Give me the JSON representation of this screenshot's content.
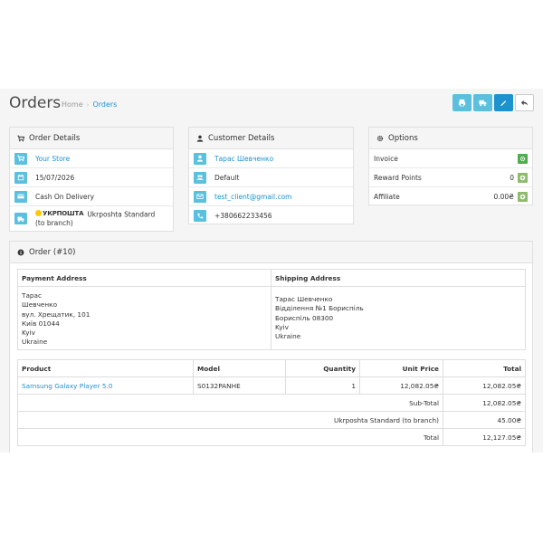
{
  "header": {
    "title": "Orders",
    "breadcrumb": [
      "Home",
      "Orders"
    ]
  },
  "colors": {
    "info": "#5bc0de",
    "primary": "#1e91cf",
    "success": "#8fbb6c",
    "success_dark": "#4cae4c"
  },
  "order_details": {
    "title": "Order Details",
    "store": "Your Store",
    "date": "15/07/2026",
    "payment": "Cash On Delivery",
    "shipping_logo": "УКРПОШТА",
    "shipping": "Ukrposhta Standard (to branch)"
  },
  "customer_details": {
    "title": "Customer Details",
    "name": "Тарас Шевченко",
    "group": "Default",
    "email": "test_client@gmail.com",
    "phone": "+380662233456"
  },
  "options": {
    "title": "Options",
    "rows": [
      {
        "label": "Invoice",
        "value": ""
      },
      {
        "label": "Reward Points",
        "value": "0"
      },
      {
        "label": "Affiliate",
        "value": "0.00₴"
      }
    ]
  },
  "order": {
    "title": "Order (#10)",
    "payment_address_label": "Payment Address",
    "shipping_address_label": "Shipping Address",
    "payment_address": [
      "Тарас",
      "Шевченко",
      "вул. Хрещатик, 101",
      "Київ 01044",
      "Kyiv",
      "Ukraine"
    ],
    "shipping_address": [
      "Тарас Шевченко",
      "Відділення №1 Бориспіль",
      "Бориспіль 08300",
      "Kyiv",
      "Ukraine"
    ],
    "columns": [
      "Product",
      "Model",
      "Quantity",
      "Unit Price",
      "Total"
    ],
    "products": [
      {
        "name": "Samsung Galaxy Player 5.0",
        "model": "S0132PANHE",
        "quantity": "1",
        "unit_price": "12,082.05₴",
        "total": "12,082.05₴"
      }
    ],
    "totals": [
      {
        "label": "Sub-Total",
        "value": "12,082.05₴"
      },
      {
        "label": "Ukrposhta Standard (to branch)",
        "value": "45.00₴"
      },
      {
        "label": "Total",
        "value": "12,127.05₴"
      }
    ]
  }
}
